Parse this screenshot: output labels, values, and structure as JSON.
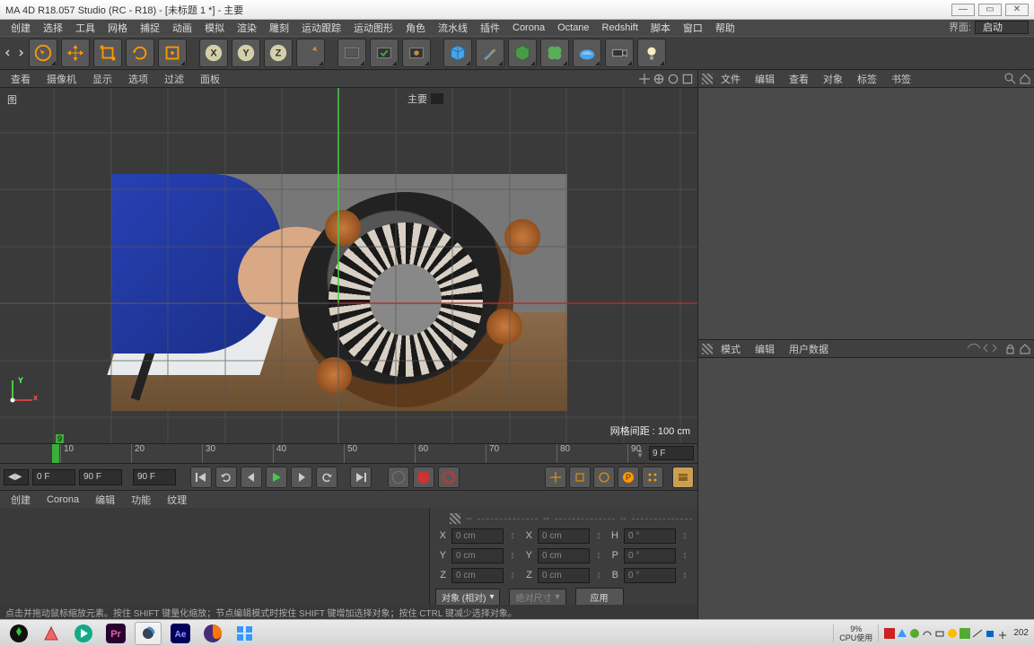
{
  "title": "MA 4D R18.057 Studio (RC - R18) - [未标题 1 *] - 主要",
  "interface": {
    "label": "界面:",
    "value": "启动"
  },
  "menus": [
    "创建",
    "选择",
    "工具",
    "网格",
    "捕捉",
    "动画",
    "模拟",
    "渲染",
    "雕刻",
    "运动跟踪",
    "运动图形",
    "角色",
    "流水线",
    "插件",
    "Corona",
    "Octane",
    "Redshift",
    "脚本",
    "窗口",
    "帮助"
  ],
  "viewport": {
    "tabs": [
      "查看",
      "摄像机",
      "显示",
      "选项",
      "过滤",
      "面板"
    ],
    "corner_label": "图",
    "center_label": "主要",
    "grid_spacing": "网格间距 : 100 cm",
    "axes": {
      "y": "Y",
      "x": "x"
    }
  },
  "timeline": {
    "ticks": [
      "10",
      "20",
      "30",
      "40",
      "50",
      "60",
      "70",
      "80",
      "90"
    ],
    "current_label": "9",
    "end_field": "9 F"
  },
  "playback": {
    "range_start": "0 F",
    "range_end": "90 F",
    "display_end": "90 F"
  },
  "materials": {
    "tabs": [
      "创建",
      "Corona",
      "编辑",
      "功能",
      "纹理"
    ]
  },
  "coords": {
    "hdr": [
      "--",
      "--",
      "--"
    ],
    "rows": [
      {
        "a": "X",
        "v1": "0 cm",
        "b": "X",
        "v2": "0 cm",
        "c": "H",
        "v3": "0 °"
      },
      {
        "a": "Y",
        "v1": "0 cm",
        "b": "Y",
        "v2": "0 cm",
        "c": "P",
        "v3": "0 °"
      },
      {
        "a": "Z",
        "v1": "0 cm",
        "b": "Z",
        "v2": "0 cm",
        "c": "B",
        "v3": "0 °"
      }
    ],
    "mode": "对象 (相对)",
    "size_mode": "绝对尺寸",
    "apply": "应用"
  },
  "objects_panel": {
    "tabs": [
      "文件",
      "编辑",
      "查看",
      "对象",
      "标签",
      "书签"
    ]
  },
  "attr_panel": {
    "tabs": [
      "模式",
      "编辑",
      "用户数据"
    ]
  },
  "hint": "点击并拖动鼠标缩放元素。按住 SHIFT 键量化缩放；节点编辑模式时按住 SHIFT 键增加选择对象；按住 CTRL 键减少选择对象。",
  "tray": {
    "cpu_pct": "9%",
    "cpu_lbl": "CPU使用",
    "year": "202"
  }
}
